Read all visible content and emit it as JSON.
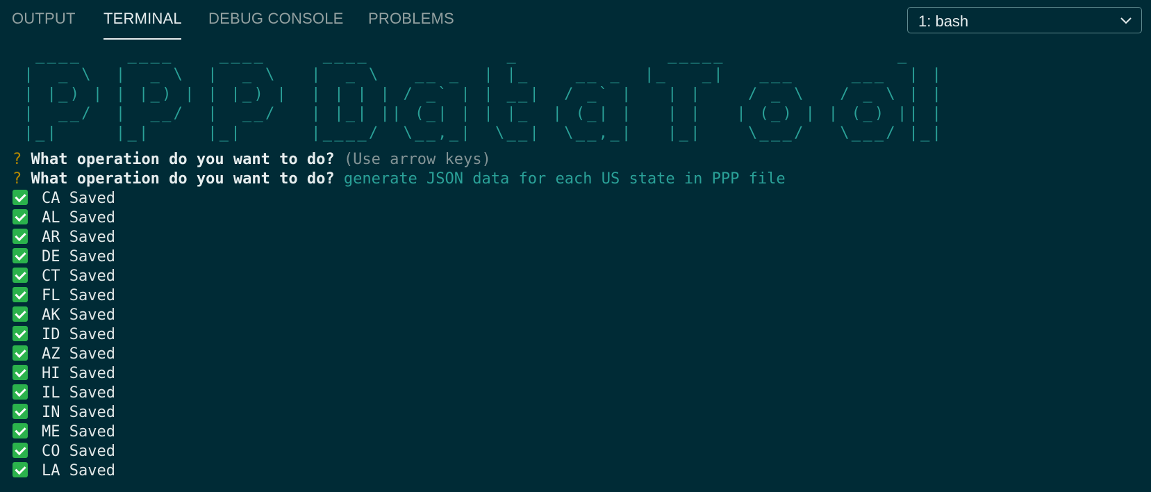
{
  "tabs": [
    {
      "label": "OUTPUT",
      "active": false
    },
    {
      "label": "TERMINAL",
      "active": true
    },
    {
      "label": "DEBUG CONSOLE",
      "active": false
    },
    {
      "label": "PROBLEMS",
      "active": false
    }
  ],
  "terminal_selector": {
    "selected": "1: bash",
    "icon": "chevron-down-icon"
  },
  "banner_ascii": [
    "  ____    ____    ____     ____            _             _____               _ ",
    " |  _ \\  |  _ \\  |  _ \\   |  _ \\   __ _  | |_    __ _  |_   _|   ___     ___  | |",
    " | |_) | | |_) | | |_) |  | | | | / _` | | __|  / _` |   | |    / _ \\   / _ \\ | |",
    " |  __/  |  __/  |  __/   | |_| || (_| | | |_  | (_| |   | |   | (_) | | (_) || |",
    " |_|     |_|     |_|      |____/  \\__,_|  \\__|  \\__,_|   |_|    \\___/   \\___/ |_|"
  ],
  "prompts": [
    {
      "mark": "?",
      "question": "What operation do you want to do?",
      "hint": "(Use arrow keys)",
      "answer": ""
    },
    {
      "mark": "?",
      "question": "What operation do you want to do?",
      "hint": "",
      "answer": "generate JSON data for each US state in PPP file"
    }
  ],
  "saved_states": [
    {
      "code": "CA",
      "status": "Saved"
    },
    {
      "code": "AL",
      "status": "Saved"
    },
    {
      "code": "AR",
      "status": "Saved"
    },
    {
      "code": "DE",
      "status": "Saved"
    },
    {
      "code": "CT",
      "status": "Saved"
    },
    {
      "code": "FL",
      "status": "Saved"
    },
    {
      "code": "AK",
      "status": "Saved"
    },
    {
      "code": "ID",
      "status": "Saved"
    },
    {
      "code": "AZ",
      "status": "Saved"
    },
    {
      "code": "HI",
      "status": "Saved"
    },
    {
      "code": "IL",
      "status": "Saved"
    },
    {
      "code": "IN",
      "status": "Saved"
    },
    {
      "code": "ME",
      "status": "Saved"
    },
    {
      "code": "CO",
      "status": "Saved"
    },
    {
      "code": "LA",
      "status": "Saved"
    }
  ],
  "colors": {
    "background": "#002b36",
    "accent": "#2aa198",
    "prompt_mark": "#b58900",
    "check": "#2bb24c"
  }
}
